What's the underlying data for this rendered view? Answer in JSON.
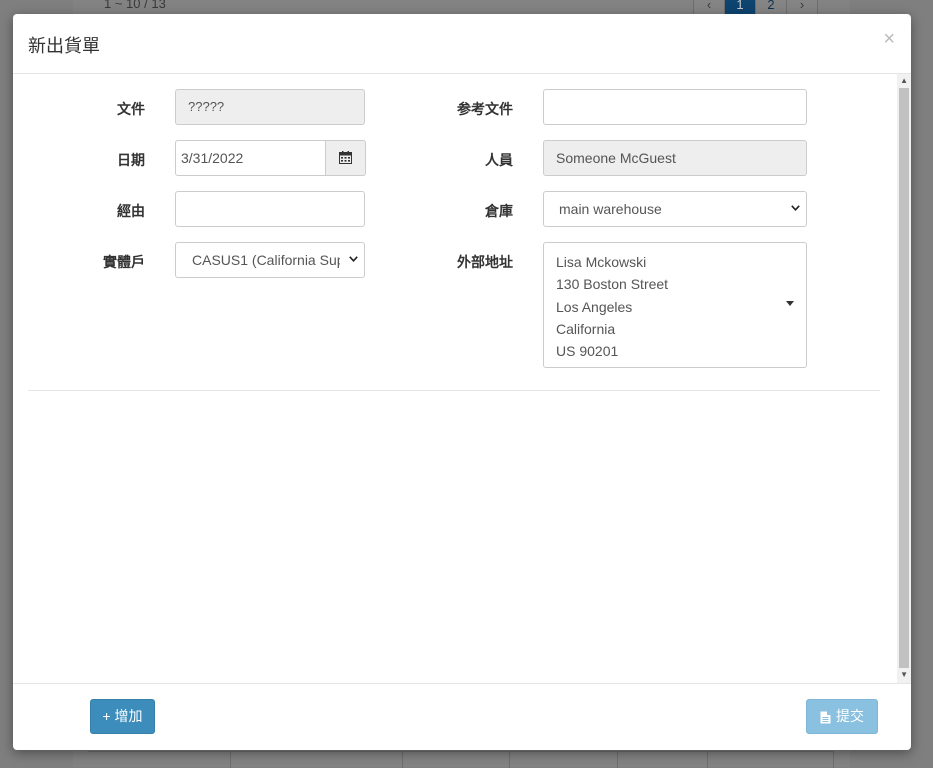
{
  "background": {
    "record_count": "1 ~ 10 / 13",
    "pager": {
      "prev": "‹",
      "pages": [
        "1",
        "2"
      ],
      "active_page": "1",
      "next": "›"
    }
  },
  "modal": {
    "title": "新出貨單",
    "close": "×",
    "fields": {
      "document": {
        "label": "文件",
        "value": "?????"
      },
      "reference_document": {
        "label": "参考文件",
        "value": ""
      },
      "date": {
        "label": "日期",
        "value": "3/31/2022"
      },
      "staff": {
        "label": "人員",
        "value": "Someone McGuest"
      },
      "via": {
        "label": "經由",
        "value": ""
      },
      "warehouse": {
        "label": "倉庫",
        "value": "main warehouse"
      },
      "entity": {
        "label": "實體戶",
        "value": "CASUS1 (California Sup"
      },
      "external_address": {
        "label": "外部地址",
        "lines": [
          "Lisa Mckowski",
          "130 Boston Street",
          "Los Angeles",
          "California",
          "US 90201"
        ]
      }
    },
    "footer": {
      "add_label": "+ 增加",
      "submit_label": "提交"
    },
    "colors": {
      "primary": "#3c8dbc",
      "primary_disabled": "#8ac0e0"
    },
    "icons": {
      "date_picker": "calendar-icon",
      "submit": "file-icon"
    }
  }
}
